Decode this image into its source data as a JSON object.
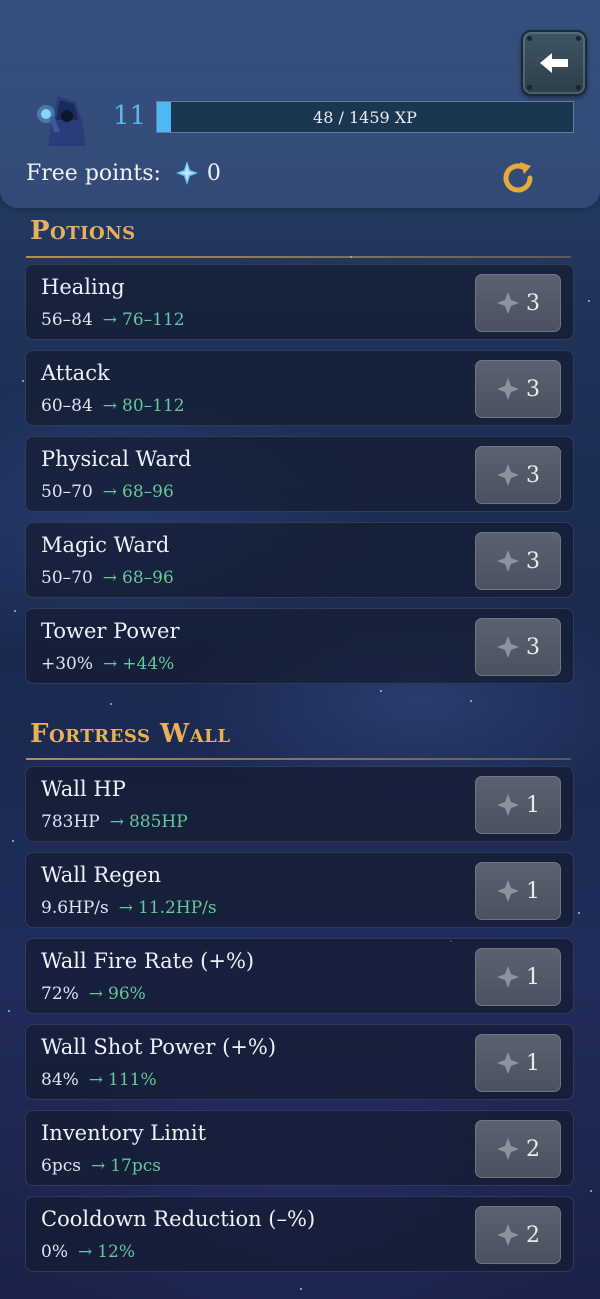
{
  "header": {
    "level": "11",
    "xp_text": "48 / 1459 XP",
    "xp_progress": 0.033,
    "free_points_label": "Free points:",
    "free_points_value": "0",
    "icons": {
      "back": "back-arrow-icon",
      "refresh": "refresh-icon",
      "gem": "gem-icon",
      "avatar": "wizard-avatar"
    }
  },
  "sections": [
    {
      "title": "Potions",
      "items": [
        {
          "name": "Healing",
          "current": "56–84",
          "next": "76–112",
          "cost": "3"
        },
        {
          "name": "Attack",
          "current": "60–84",
          "next": "80–112",
          "cost": "3"
        },
        {
          "name": "Physical Ward",
          "current": "50–70",
          "next": "68–96",
          "cost": "3"
        },
        {
          "name": "Magic Ward",
          "current": "50–70",
          "next": "68–96",
          "cost": "3"
        },
        {
          "name": "Tower Power",
          "current": "+30%",
          "next": "+44%",
          "cost": "3"
        }
      ]
    },
    {
      "title": "Fortress Wall",
      "items": [
        {
          "name": "Wall HP",
          "current": "783HP",
          "next": "885HP",
          "cost": "1"
        },
        {
          "name": "Wall Regen",
          "current": "9.6HP/s",
          "next": "11.2HP/s",
          "cost": "1"
        },
        {
          "name": "Wall Fire Rate (+%)",
          "current": "72%",
          "next": "96%",
          "cost": "1"
        },
        {
          "name": "Wall Shot Power (+%)",
          "current": "84%",
          "next": "111%",
          "cost": "1"
        },
        {
          "name": "Inventory Limit",
          "current": "6pcs",
          "next": "17pcs",
          "cost": "2"
        },
        {
          "name": "Cooldown Reduction (–%)",
          "current": "0%",
          "next": "12%",
          "cost": "2"
        }
      ]
    }
  ],
  "arrow_symbol": "→",
  "colors": {
    "accent_gold": "#e6b15a",
    "level_blue": "#5ab6ef",
    "upgrade_green": "#67c79a",
    "xp_fill": "#4fb8f2"
  }
}
